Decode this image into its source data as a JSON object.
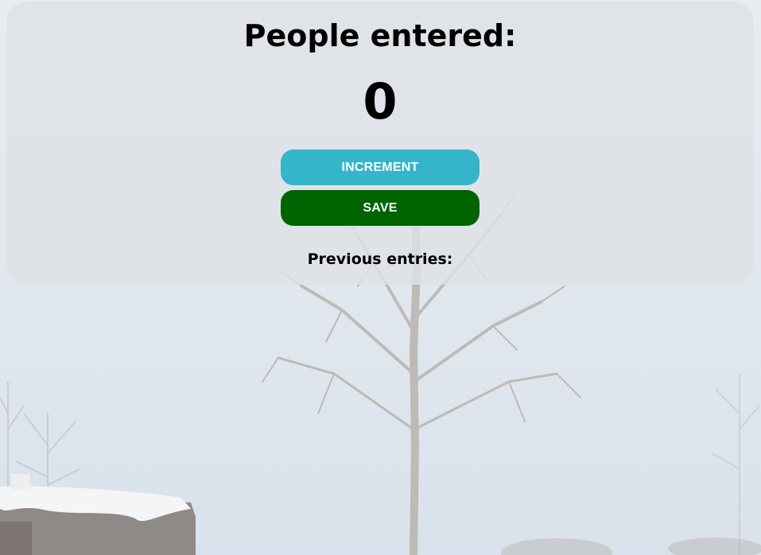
{
  "counter": {
    "title": "People entered:",
    "value": "0"
  },
  "actions": {
    "increment_label": "INCREMENT",
    "save_label": "SAVE"
  },
  "history": {
    "label": "Previous entries:",
    "entries": []
  },
  "colors": {
    "increment_button": "#35b5c9",
    "save_button": "#006400",
    "panel": "#dee2e5",
    "text": "#000000"
  }
}
